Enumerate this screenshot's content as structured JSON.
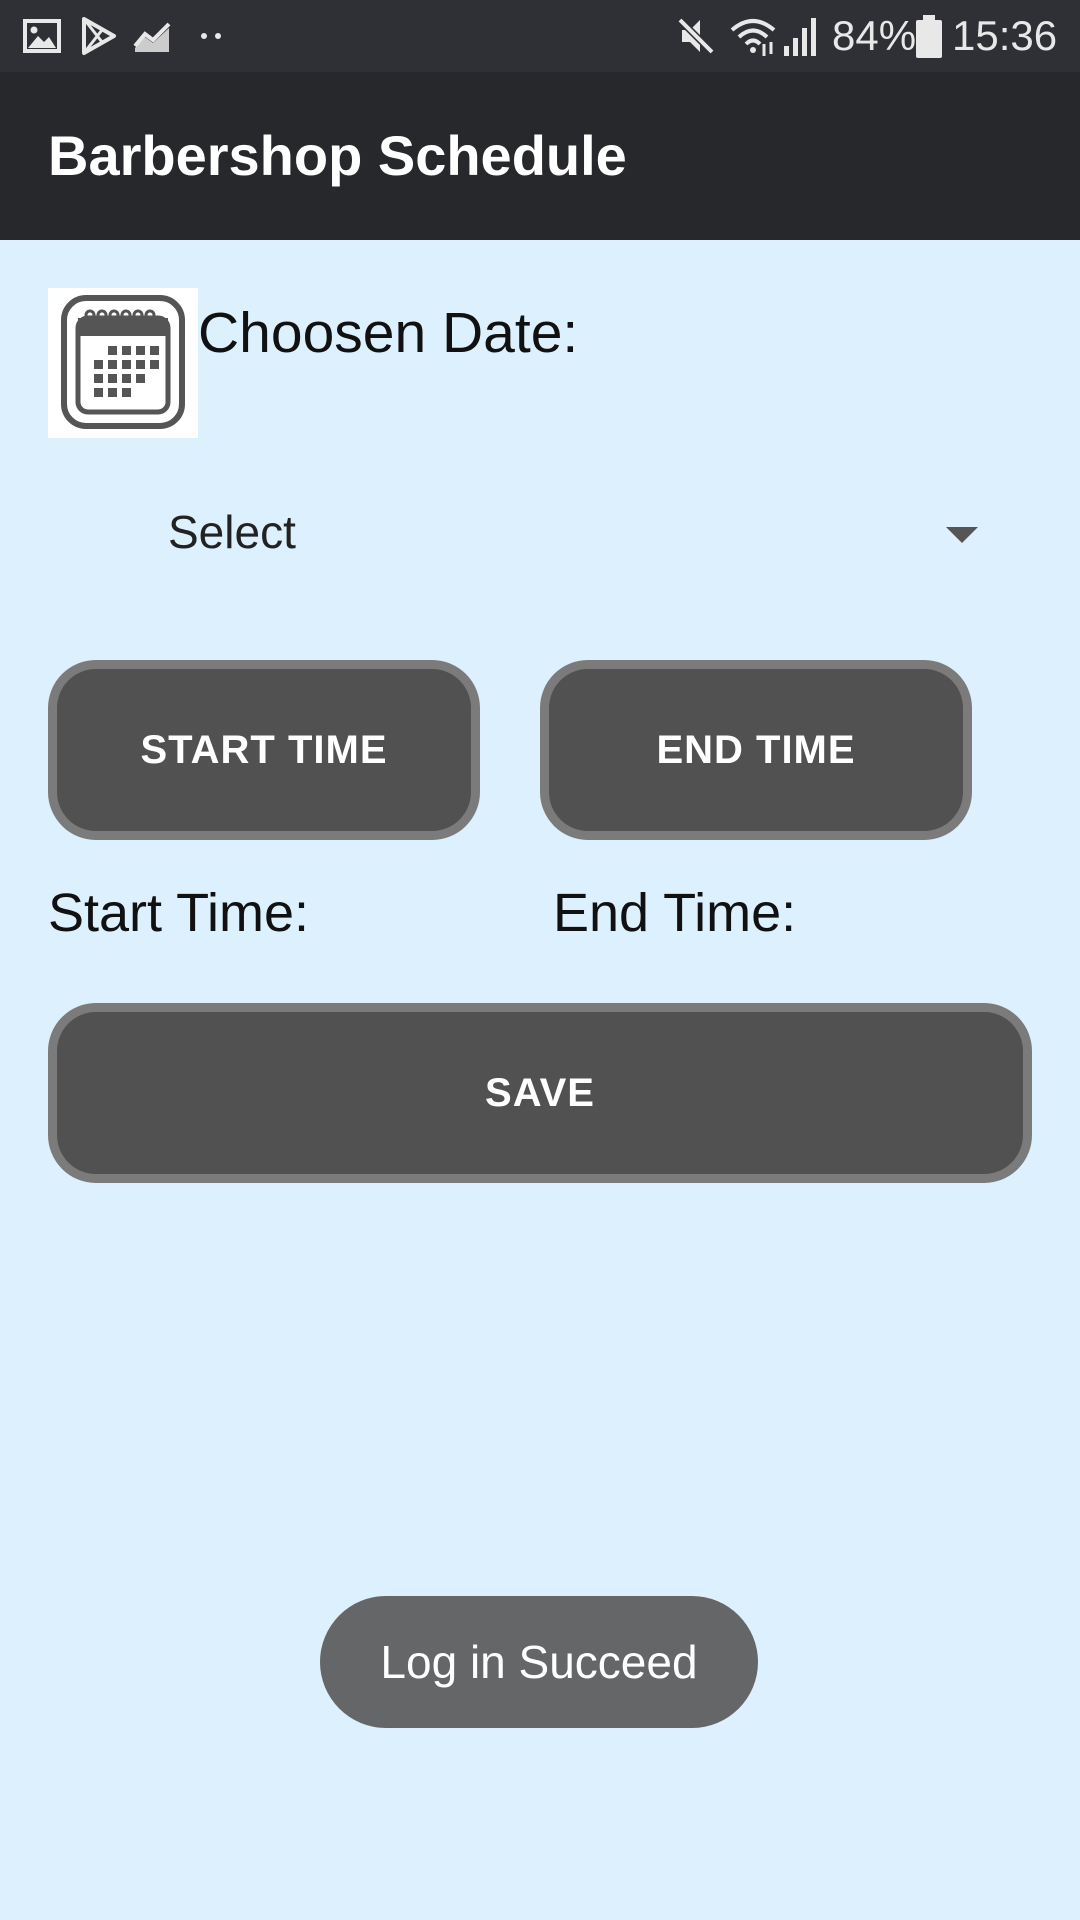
{
  "status_bar": {
    "battery": "84%",
    "time": "15:36",
    "left_icons": [
      "gallery-icon",
      "play-store-icon",
      "stats-icon",
      "more-dots-icon"
    ],
    "right_icons": [
      "mute-icon",
      "wifi-icon",
      "signal-icon",
      "battery-icon"
    ]
  },
  "app_bar": {
    "title": "Barbershop Schedule",
    "background": "#27282c"
  },
  "date_section": {
    "icon": "calendar-icon",
    "label": "Choosen Date:"
  },
  "spinner": {
    "selected": "Select"
  },
  "buttons": {
    "start_time": "START TIME",
    "end_time": "END TIME",
    "save": "SAVE"
  },
  "labels": {
    "start_time": "Start Time:",
    "end_time": "End Time:"
  },
  "toast": {
    "message": "Log in Succeed"
  },
  "colors": {
    "page_background": "#dcf0fd",
    "button_fill": "#515151",
    "button_border": "#7b7b7c",
    "toast_background": "#656667"
  }
}
